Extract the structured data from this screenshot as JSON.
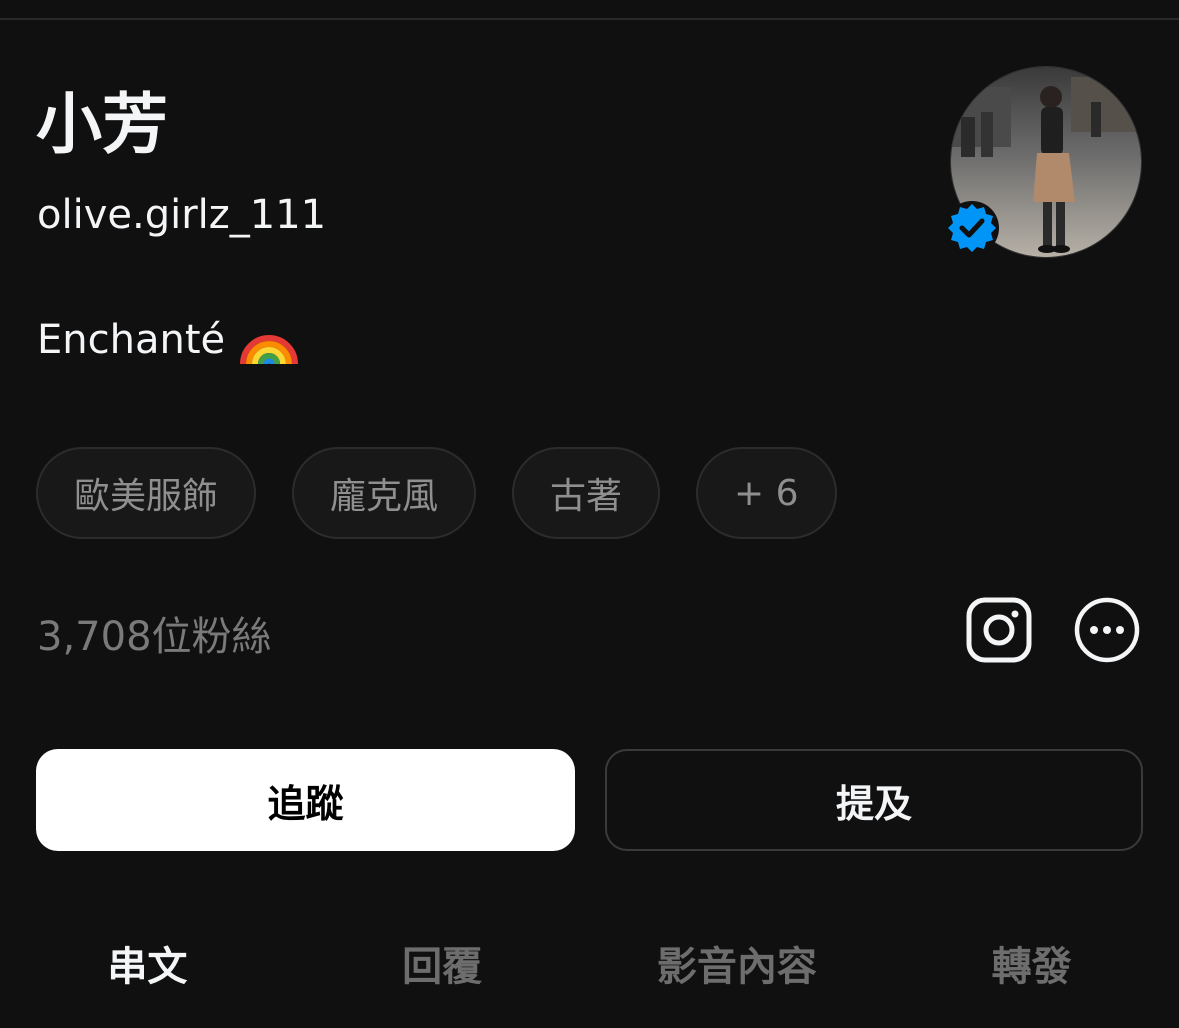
{
  "profile": {
    "display_name": "小芳",
    "username": "olive.girlz_111",
    "bio": "Enchanté",
    "bio_emoji": "rainbow-icon",
    "verified": true,
    "avatar_icon": "profile-photo"
  },
  "tags": [
    {
      "label": "歐美服飾"
    },
    {
      "label": "龐克風"
    },
    {
      "label": "古著"
    },
    {
      "label": "+ 6"
    }
  ],
  "stats": {
    "followers": "3,708位粉絲"
  },
  "links": {
    "instagram_icon": "instagram-icon",
    "more_icon": "more-options-icon"
  },
  "actions": {
    "follow_label": "追蹤",
    "mention_label": "提及"
  },
  "tabs": [
    {
      "label": "串文",
      "active": true
    },
    {
      "label": "回覆",
      "active": false
    },
    {
      "label": "影音內容",
      "active": false
    },
    {
      "label": "轉發",
      "active": false
    }
  ],
  "colors": {
    "background": "#101010",
    "text": "#f3f5f7",
    "muted": "#7a7a7a",
    "verified": "#0095f6"
  }
}
